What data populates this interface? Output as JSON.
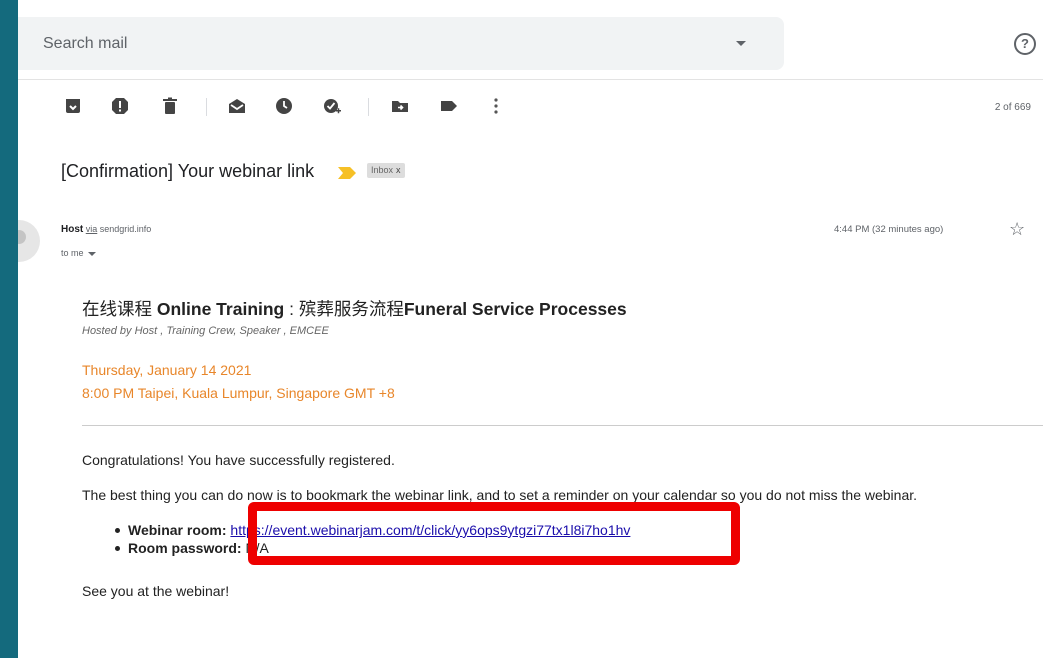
{
  "search": {
    "placeholder": "Search mail"
  },
  "toolbar": {
    "icons": [
      "archive-icon",
      "report-spam-icon",
      "delete-icon",
      "mark-unread-icon",
      "snooze-icon",
      "add-task-icon",
      "move-to-icon",
      "label-icon",
      "more-icon"
    ],
    "counter": "2 of 669"
  },
  "email": {
    "subject": "[Confirmation] Your webinar link",
    "inbox_badge": "Inbox",
    "badge_close": "x",
    "sender_name": "Host",
    "via_label": "via",
    "via_domain": "sendgrid.info",
    "to_label": "to me",
    "time": "4:44 PM (32 minutes ago)",
    "body": {
      "title_cn": "在线课程 ",
      "title_en": "Online Training",
      "title_mid": " : 殡葬服务流程",
      "title_tail": "Funeral Service Processes",
      "hosted_by": "Hosted by Host , Training Crew, Speaker , EMCEE",
      "date": "Thursday, January 14 2021",
      "time": "8:00 PM Taipei, Kuala Lumpur, Singapore GMT +8",
      "congrats": "Congratulations! You have successfully registered.",
      "advice": "The best thing you can do now is to bookmark the webinar link, and to set a reminder on your calendar so you do not miss the webinar.",
      "room_label": "Webinar room: ",
      "room_link": "https://event.webinarjam.com/t/click/yy6ops9ytgzi77tx1l8i7ho1hv",
      "password_label": "Room password: ",
      "password_value": "N/A",
      "closing": "See you at the webinar!"
    }
  },
  "colors": {
    "background": "#146a7d",
    "accent_orange": "#e8862a",
    "link": "#1a0dab",
    "highlight_box": "#ee0000",
    "importance_marker": "#f6c026"
  }
}
